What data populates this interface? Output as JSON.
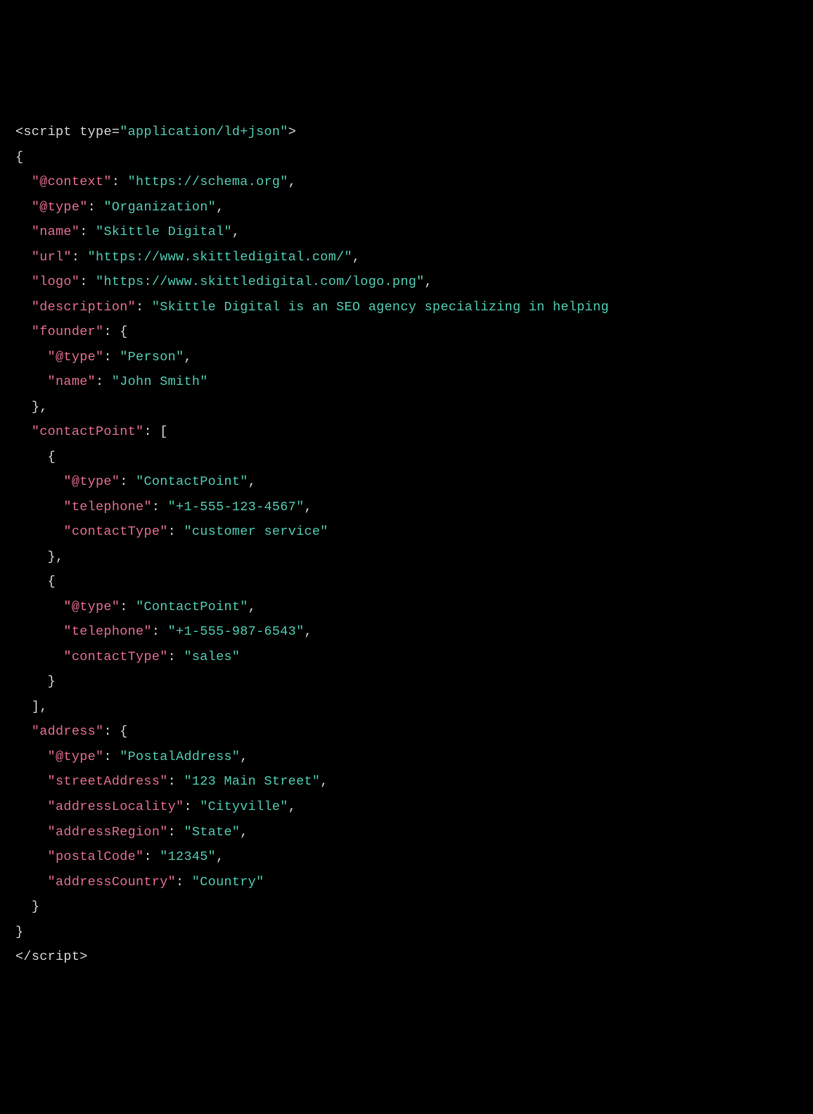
{
  "code": {
    "scriptOpen": {
      "lt": "<",
      "tagName": "script",
      "space": " ",
      "attrName": "type",
      "eq": "=",
      "q1": "\"",
      "attrValue": "application/ld+json",
      "q2": "\"",
      "gt": ">"
    },
    "scriptClose": {
      "lt": "<",
      "slash": "/",
      "tagName": "script",
      "gt": ">"
    },
    "openBrace": "{",
    "closeBrace": "}",
    "lines": {
      "context": {
        "key": "\"@context\"",
        "val": "\"https://schema.org\""
      },
      "type": {
        "key": "\"@type\"",
        "val": "\"Organization\""
      },
      "name": {
        "key": "\"name\"",
        "val": "\"Skittle Digital\""
      },
      "url": {
        "key": "\"url\"",
        "val": "\"https://www.skittledigital.com/\""
      },
      "logo": {
        "key": "\"logo\"",
        "val": "\"https://www.skittledigital.com/logo.png\""
      },
      "description": {
        "key": "\"description\"",
        "val": "\"Skittle Digital is an SEO agency specializing in helping"
      },
      "founder": {
        "key": "\"founder\""
      },
      "founderType": {
        "key": "\"@type\"",
        "val": "\"Person\""
      },
      "founderName": {
        "key": "\"name\"",
        "val": "\"John Smith\""
      },
      "contactPoint": {
        "key": "\"contactPoint\""
      },
      "cp1Type": {
        "key": "\"@type\"",
        "val": "\"ContactPoint\""
      },
      "cp1Tel": {
        "key": "\"telephone\"",
        "val": "\"+1-555-123-4567\""
      },
      "cp1CT": {
        "key": "\"contactType\"",
        "val": "\"customer service\""
      },
      "cp2Type": {
        "key": "\"@type\"",
        "val": "\"ContactPoint\""
      },
      "cp2Tel": {
        "key": "\"telephone\"",
        "val": "\"+1-555-987-6543\""
      },
      "cp2CT": {
        "key": "\"contactType\"",
        "val": "\"sales\""
      },
      "address": {
        "key": "\"address\""
      },
      "addrType": {
        "key": "\"@type\"",
        "val": "\"PostalAddress\""
      },
      "addrStreet": {
        "key": "\"streetAddress\"",
        "val": "\"123 Main Street\""
      },
      "addrLocality": {
        "key": "\"addressLocality\"",
        "val": "\"Cityville\""
      },
      "addrRegion": {
        "key": "\"addressRegion\"",
        "val": "\"State\""
      },
      "addrPostal": {
        "key": "\"postalCode\"",
        "val": "\"12345\""
      },
      "addrCountry": {
        "key": "\"addressCountry\"",
        "val": "\"Country\""
      }
    }
  }
}
